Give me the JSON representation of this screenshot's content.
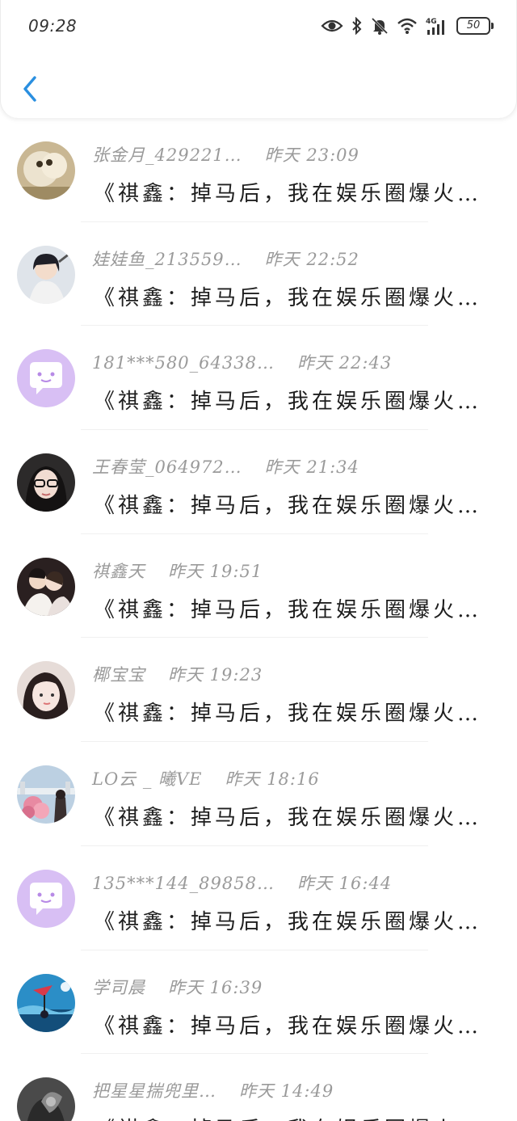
{
  "status_bar": {
    "time": "09:28",
    "battery": "50",
    "network": "4G"
  },
  "header": {
    "back_icon": "chevron-left-icon",
    "accent": "#2a8fe0"
  },
  "messages": [
    {
      "name": "张金月_429221…",
      "time": "昨天 23:09",
      "preview": "《祺鑫：掉马后，我在娱乐圈爆火…",
      "avatar": "cat-photo"
    },
    {
      "name": "娃娃鱼_213559…",
      "time": "昨天 22:52",
      "preview": "《祺鑫：掉马后，我在娱乐圈爆火…",
      "avatar": "anime-girl-photo"
    },
    {
      "name": "181***580_64338…",
      "time": "昨天 22:43",
      "preview": "《祺鑫：掉马后，我在娱乐圈爆火…",
      "avatar": "default-chat-avatar"
    },
    {
      "name": "王春莹_064972…",
      "time": "昨天 21:34",
      "preview": "《祺鑫：掉马后，我在娱乐圈爆火…",
      "avatar": "girl-glasses-photo"
    },
    {
      "name": "祺鑫天",
      "time": "昨天 19:51",
      "preview": "《祺鑫：掉马后，我在娱乐圈爆火…",
      "avatar": "couple-photo"
    },
    {
      "name": "椰宝宝",
      "time": "昨天 19:23",
      "preview": "《祺鑫：掉马后，我在娱乐圈爆火…",
      "avatar": "girl-portrait-photo"
    },
    {
      "name": "LO云 _ 曦VE",
      "time": "昨天 18:16",
      "preview": "《祺鑫：掉马后，我在娱乐圈爆火…",
      "avatar": "flowers-photo"
    },
    {
      "name": "135***144_89858…",
      "time": "昨天 16:44",
      "preview": "《祺鑫：掉马后，我在娱乐圈爆火…",
      "avatar": "default-chat-avatar"
    },
    {
      "name": "学司晨",
      "time": "昨天 16:39",
      "preview": "《祺鑫：掉马后，我在娱乐圈爆火…",
      "avatar": "blue-illustration-photo"
    },
    {
      "name": "把星星揣兜里…",
      "time": "昨天 14:49",
      "preview": "《祺鑫：掉马后，我在娱乐圈爆火…",
      "avatar": "dark-photo"
    }
  ]
}
